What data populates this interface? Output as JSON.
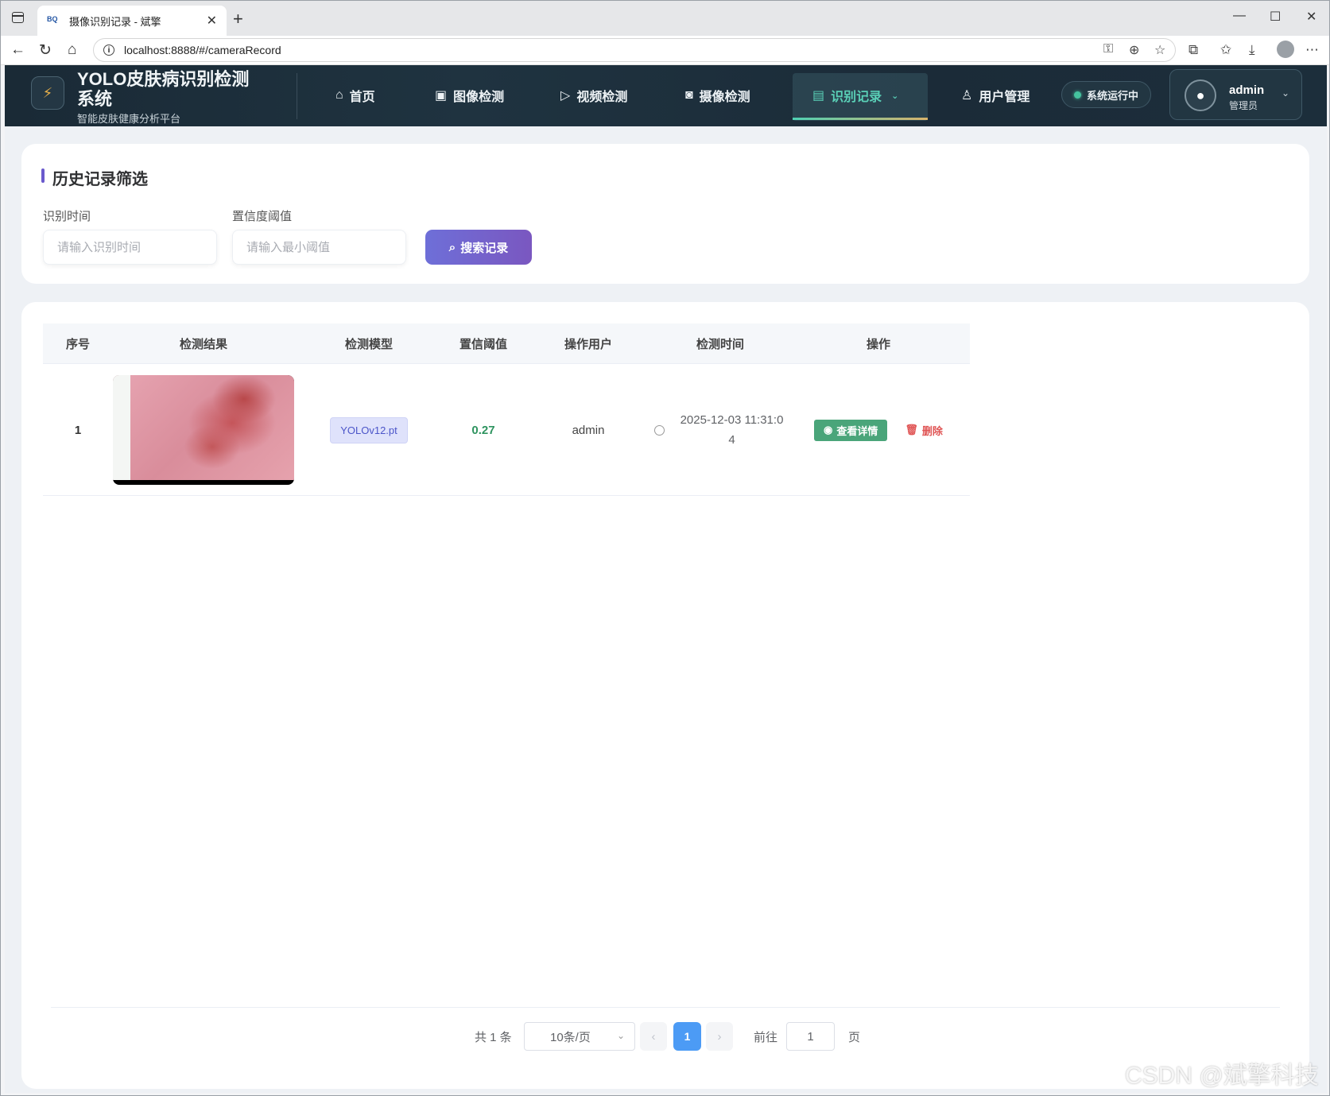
{
  "browser": {
    "tab_title": "摄像识别记录 - 斌擎",
    "tab_favicon": "BQ",
    "url": "localhost:8888/#/cameraRecord"
  },
  "header": {
    "brand_title": "YOLO皮肤病识别检测系统",
    "brand_subtitle": "智能皮肤健康分析平台",
    "nav": [
      {
        "label": "首页",
        "icon": "home-icon"
      },
      {
        "label": "图像检测",
        "icon": "image-icon"
      },
      {
        "label": "视频检测",
        "icon": "play-icon"
      },
      {
        "label": "摄像检测",
        "icon": "camera-icon"
      },
      {
        "label": "识别记录",
        "icon": "document-icon",
        "active": true
      },
      {
        "label": "用户管理",
        "icon": "user-icon"
      }
    ],
    "status": "系统运行中",
    "user_name": "admin",
    "user_role": "管理员"
  },
  "filter": {
    "title": "历史记录筛选",
    "time_label": "识别时间",
    "time_placeholder": "请输入识别时间",
    "conf_label": "置信度阈值",
    "conf_placeholder": "请输入最小阈值",
    "search_label": "搜索记录"
  },
  "table": {
    "columns": [
      "序号",
      "检测结果",
      "检测模型",
      "置信阈值",
      "操作用户",
      "检测时间",
      "操作"
    ],
    "rows": [
      {
        "index": "1",
        "model": "YOLOv12.pt",
        "confidence": "0.27",
        "user": "admin",
        "time": "2025-12-03 11:31:04",
        "detail_label": "查看详情",
        "delete_label": "删除"
      }
    ]
  },
  "pagination": {
    "total": "共 1 条",
    "page_size": "10条/页",
    "current": "1",
    "goto_label": "前往",
    "goto_value": "1",
    "page_unit": "页"
  },
  "watermark": "CSDN @斌擎科技",
  "colors": {
    "accent": "#5ad0b7",
    "primary_button": "#7162cf",
    "success": "#4aa57a",
    "danger": "#e05656",
    "page_current": "#4c9bf5"
  }
}
